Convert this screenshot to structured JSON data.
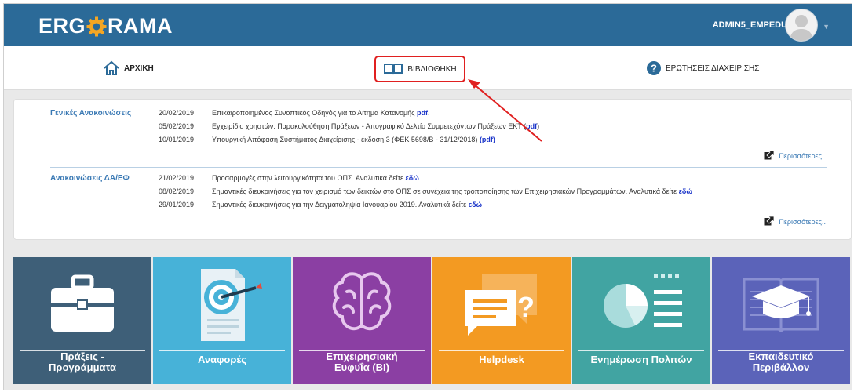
{
  "header": {
    "logo_left": "ERG",
    "logo_right": "RAMA",
    "username": "ADMIN5_EMPEDU"
  },
  "nav": {
    "home": "ΑΡΧΙΚΗ",
    "library": "ΒΙΒΛΙΟΘΗΚΗ",
    "faq": "ΕΡΩΤΗΣΕΙΣ ΔΙΑΧΕΙΡΙΣΗΣ"
  },
  "announcements": {
    "general": {
      "title": "Γενικές Ανακοινώσεις",
      "items": [
        {
          "date": "20/02/2019",
          "text": "Επικαιροποιημένος Συνοπτικός Οδηγός για το Αίτημα Κατανομής ",
          "link": "pdf",
          "after": "."
        },
        {
          "date": "05/02/2019",
          "text": "Εγχειρίδιο χρηστών: Παρακολούθηση Πράξεων - Απογραφικό Δελτίο Συμμετεχόντων Πράξεων ΕΚΤ (",
          "link": "pdf",
          "after": ")"
        },
        {
          "date": "10/01/2019",
          "text": "Υπουργική Απόφαση Συστήματος Διαχείρισης - έκδοση 3 (ΦΕΚ 5698/Β - 31/12/2018) ",
          "link": "(pdf)",
          "after": ""
        }
      ],
      "more": "Περισσότερες.."
    },
    "da_ef": {
      "title": "Ανακοινώσεις ΔΑ/ΕΦ",
      "items": [
        {
          "date": "21/02/2019",
          "text": "Προσαρμογές στην λειτουργικότητα του ΟΠΣ. Αναλυτικά δείτε ",
          "link": "εδώ",
          "after": ""
        },
        {
          "date": "08/02/2019",
          "text": "Σημαντικές διευκρινήσεις για τον χειρισμό των δεικτών στο ΟΠΣ σε συνέχεια της τροποποίησης των Επιχειρησιακών Προγραμμάτων. Αναλυτικά δείτε ",
          "link": "εδώ",
          "after": ""
        },
        {
          "date": "29/01/2019",
          "text": "Σημαντικές διευκρινήσεις για την Δειγματοληψία Ιανουαρίου 2019. Αναλυτικά δείτε ",
          "link": "εδώ",
          "after": ""
        }
      ],
      "more": "Περισσότερες.."
    }
  },
  "tiles": [
    {
      "line1": "Πράξεις -",
      "line2": "Προγράμματα",
      "color": "#3e5f78",
      "icon": "briefcase-icon"
    },
    {
      "line1": "Αναφορές",
      "line2": "",
      "color": "#47b2d8",
      "icon": "target-report-icon"
    },
    {
      "line1": "Επιχειρησιακή",
      "line2": "Ευφυΐα (BI)",
      "color": "#8b3fa3",
      "icon": "brain-icon"
    },
    {
      "line1": "Helpdesk",
      "line2": "",
      "color": "#f39a22",
      "icon": "help-chat-icon"
    },
    {
      "line1": "Ενημέρωση Πολιτών",
      "line2": "",
      "color": "#41a4a2",
      "icon": "pie-chart-icon"
    },
    {
      "line1": "Εκπαιδευτικό",
      "line2": "Περιβάλλον",
      "color": "#5b63b9",
      "icon": "graduation-cap-icon"
    }
  ]
}
